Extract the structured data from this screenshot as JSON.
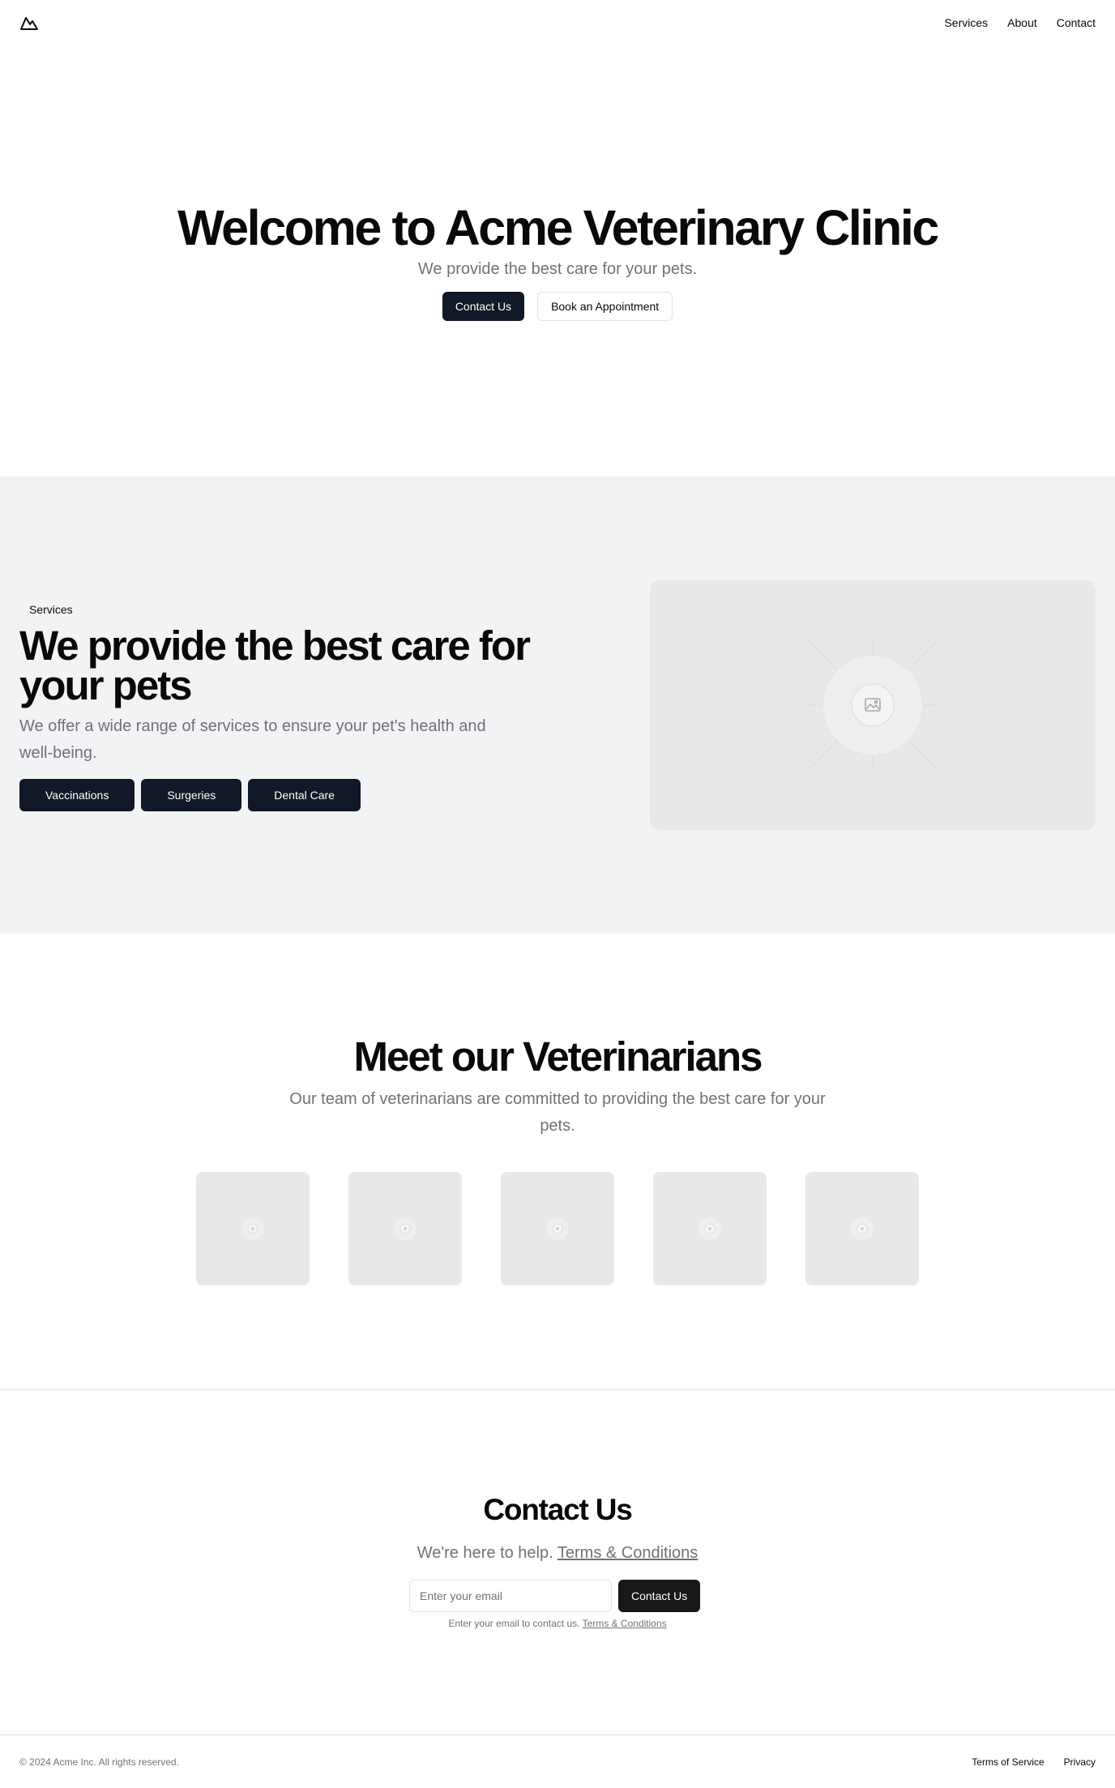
{
  "header": {
    "logo_icon": "mountain-icon",
    "nav": [
      {
        "label": "Services"
      },
      {
        "label": "About"
      },
      {
        "label": "Contact"
      }
    ]
  },
  "hero": {
    "title": "Welcome to Acme Veterinary Clinic",
    "subtitle": "We provide the best care for your pets.",
    "primary_button": "Contact Us",
    "secondary_button": "Book an Appointment"
  },
  "services": {
    "badge": "Services",
    "title": "We provide the best care for your pets",
    "description": "We offer a wide range of services to ensure your pet's health and well-being.",
    "buttons": [
      "Vaccinations",
      "Surgeries",
      "Dental Care"
    ],
    "image_icon": "image-placeholder-icon"
  },
  "vets": {
    "title": "Meet our Veterinarians",
    "description": "Our team of veterinarians are committed to providing the best care for your pets.",
    "card_count": 5
  },
  "contact": {
    "title": "Contact Us",
    "subtitle": "We're here to help.",
    "subtitle_link": "Terms & Conditions",
    "email_placeholder": "Enter your email",
    "submit_button": "Contact Us",
    "hint": "Enter your email to contact us.",
    "hint_link": "Terms & Conditions"
  },
  "footer": {
    "copyright": "© 2024 Acme Inc. All rights reserved.",
    "links": [
      "Terms of Service",
      "Privacy"
    ]
  },
  "colors": {
    "primary_dark": "#111827",
    "muted_text": "#71717a",
    "section_bg": "#f2f3f5",
    "placeholder_bg": "#e8e8e8"
  }
}
